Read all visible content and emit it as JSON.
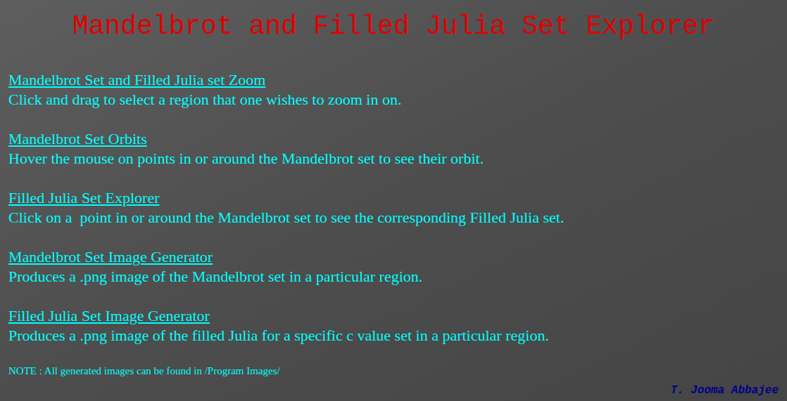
{
  "page": {
    "title": "Mandelbrot and Filled Julia Set Explorer"
  },
  "items": [
    {
      "link": "Mandelbrot Set and Filled Julia set Zoom",
      "description": "Click and drag to select a region that one wishes to zoom in on."
    },
    {
      "link": "Mandelbrot Set Orbits",
      "description": "Hover the mouse on points in or around the Mandelbrot set to see their orbit."
    },
    {
      "link": "Filled Julia Set Explorer",
      "description": "Click on a  point in or around the Mandelbrot set to see the corresponding Filled Julia set."
    },
    {
      "link": "Mandelbrot Set Image Generator",
      "description": "Produces a .png image of the Mandelbrot set in a particular region."
    },
    {
      "link": "Filled Julia Set Image Generator",
      "description": "Produces a .png image of the filled Julia for a specific c value set in a particular region."
    }
  ],
  "note": "NOTE : All generated images can be found in /Program Images/",
  "author": "T. Jooma Abbajee"
}
